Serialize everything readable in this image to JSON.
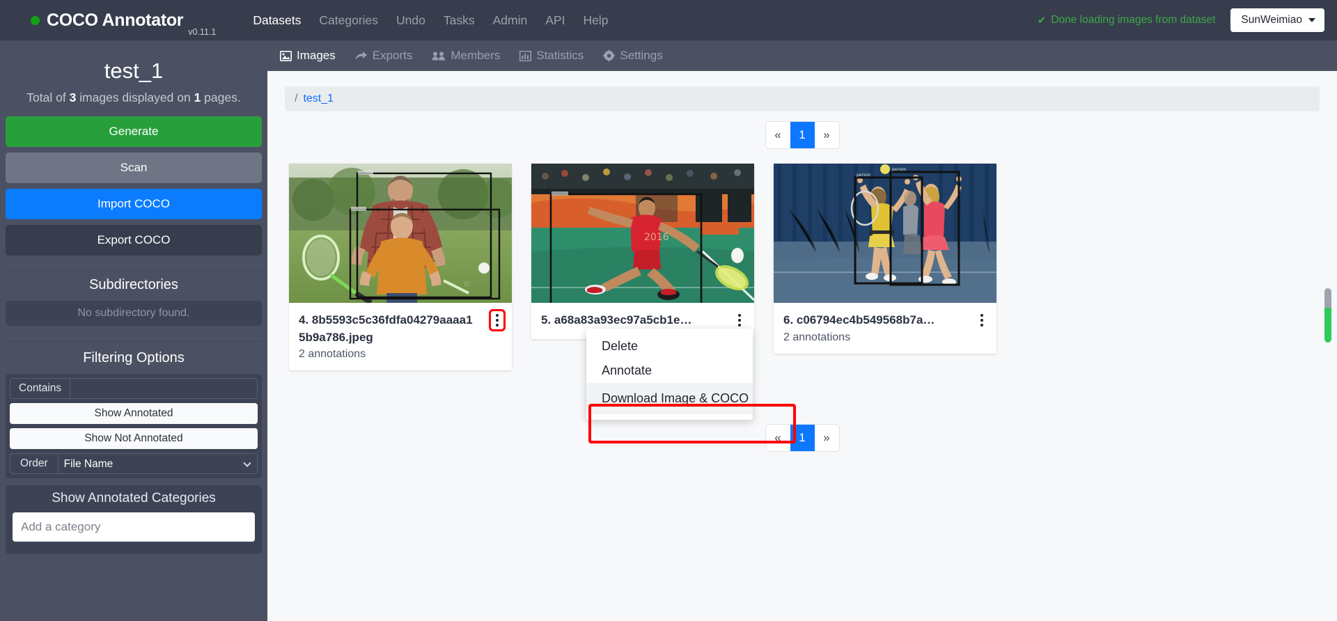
{
  "navbar": {
    "brand": "COCO Annotator",
    "version": "v0.11.1",
    "links": [
      {
        "label": "Datasets",
        "active": true
      },
      {
        "label": "Categories",
        "active": false
      },
      {
        "label": "Undo",
        "active": false
      },
      {
        "label": "Tasks",
        "active": false
      },
      {
        "label": "Admin",
        "active": false
      },
      {
        "label": "API",
        "active": false
      },
      {
        "label": "Help",
        "active": false
      }
    ],
    "status_text": "Done loading images from dataset",
    "status_color": "#3aa845",
    "status_icon": "check-icon",
    "user": "SunWeimiao"
  },
  "sidebar": {
    "dataset_title": "test_1",
    "summary_prefix": "Total of ",
    "summary_count": "3",
    "summary_mid": " images displayed on ",
    "summary_pages": "1",
    "summary_suffix": " pages.",
    "buttons": {
      "generate": "Generate",
      "scan": "Scan",
      "import": "Import COCO",
      "export": "Export COCO"
    },
    "subdirectories": {
      "title": "Subdirectories",
      "empty": "No subdirectory found."
    },
    "filtering": {
      "title": "Filtering Options",
      "contains_label": "Contains",
      "contains_value": "",
      "contains_placeholder": "",
      "show_annotated": "Show Annotated",
      "show_not_annotated": "Show Not Annotated",
      "order_label": "Order",
      "order_value": "File Name",
      "order_options": [
        "File Name"
      ]
    },
    "categories": {
      "title": "Show Annotated Categories",
      "input_placeholder": "Add a category",
      "input_value": ""
    }
  },
  "tabs": [
    {
      "label": "Images",
      "icon": "image-icon",
      "active": true
    },
    {
      "label": "Exports",
      "icon": "share-icon",
      "active": false
    },
    {
      "label": "Members",
      "icon": "users-icon",
      "active": false
    },
    {
      "label": "Statistics",
      "icon": "bar-chart-icon",
      "active": false
    },
    {
      "label": "Settings",
      "icon": "gear-icon",
      "active": false
    }
  ],
  "breadcrumb": {
    "separator": "/",
    "current": "test_1"
  },
  "pagination": {
    "prev": "«",
    "next": "»",
    "pages": [
      "1"
    ],
    "active_page": "1"
  },
  "cards": [
    {
      "title": "4. 8b5593c5c36fdfa04279aaaa15b9a786.jpeg",
      "annotations": "2 annotations",
      "kebab_icon": "kebab-menu-icon",
      "kebab_highlighted": true,
      "scene": "badminton-father-son"
    },
    {
      "title": "5. a68a83a93ec97a5cb1e…",
      "annotations": "",
      "kebab_icon": "kebab-menu-icon",
      "kebab_highlighted": false,
      "scene": "badminton-player-red"
    },
    {
      "title": "6. c06794ec4b549568b7a…",
      "annotations": "2 annotations",
      "kebab_icon": "kebab-menu-icon",
      "kebab_highlighted": false,
      "scene": "badminton-two-women"
    }
  ],
  "dropdown": {
    "items": [
      {
        "label": "Delete",
        "hover": false,
        "highlighted": false
      },
      {
        "label": "Annotate",
        "hover": false,
        "highlighted": false
      },
      {
        "label": "Download Image & COCO",
        "hover": true,
        "highlighted": true
      }
    ],
    "highlight_color": "#ff0000"
  }
}
